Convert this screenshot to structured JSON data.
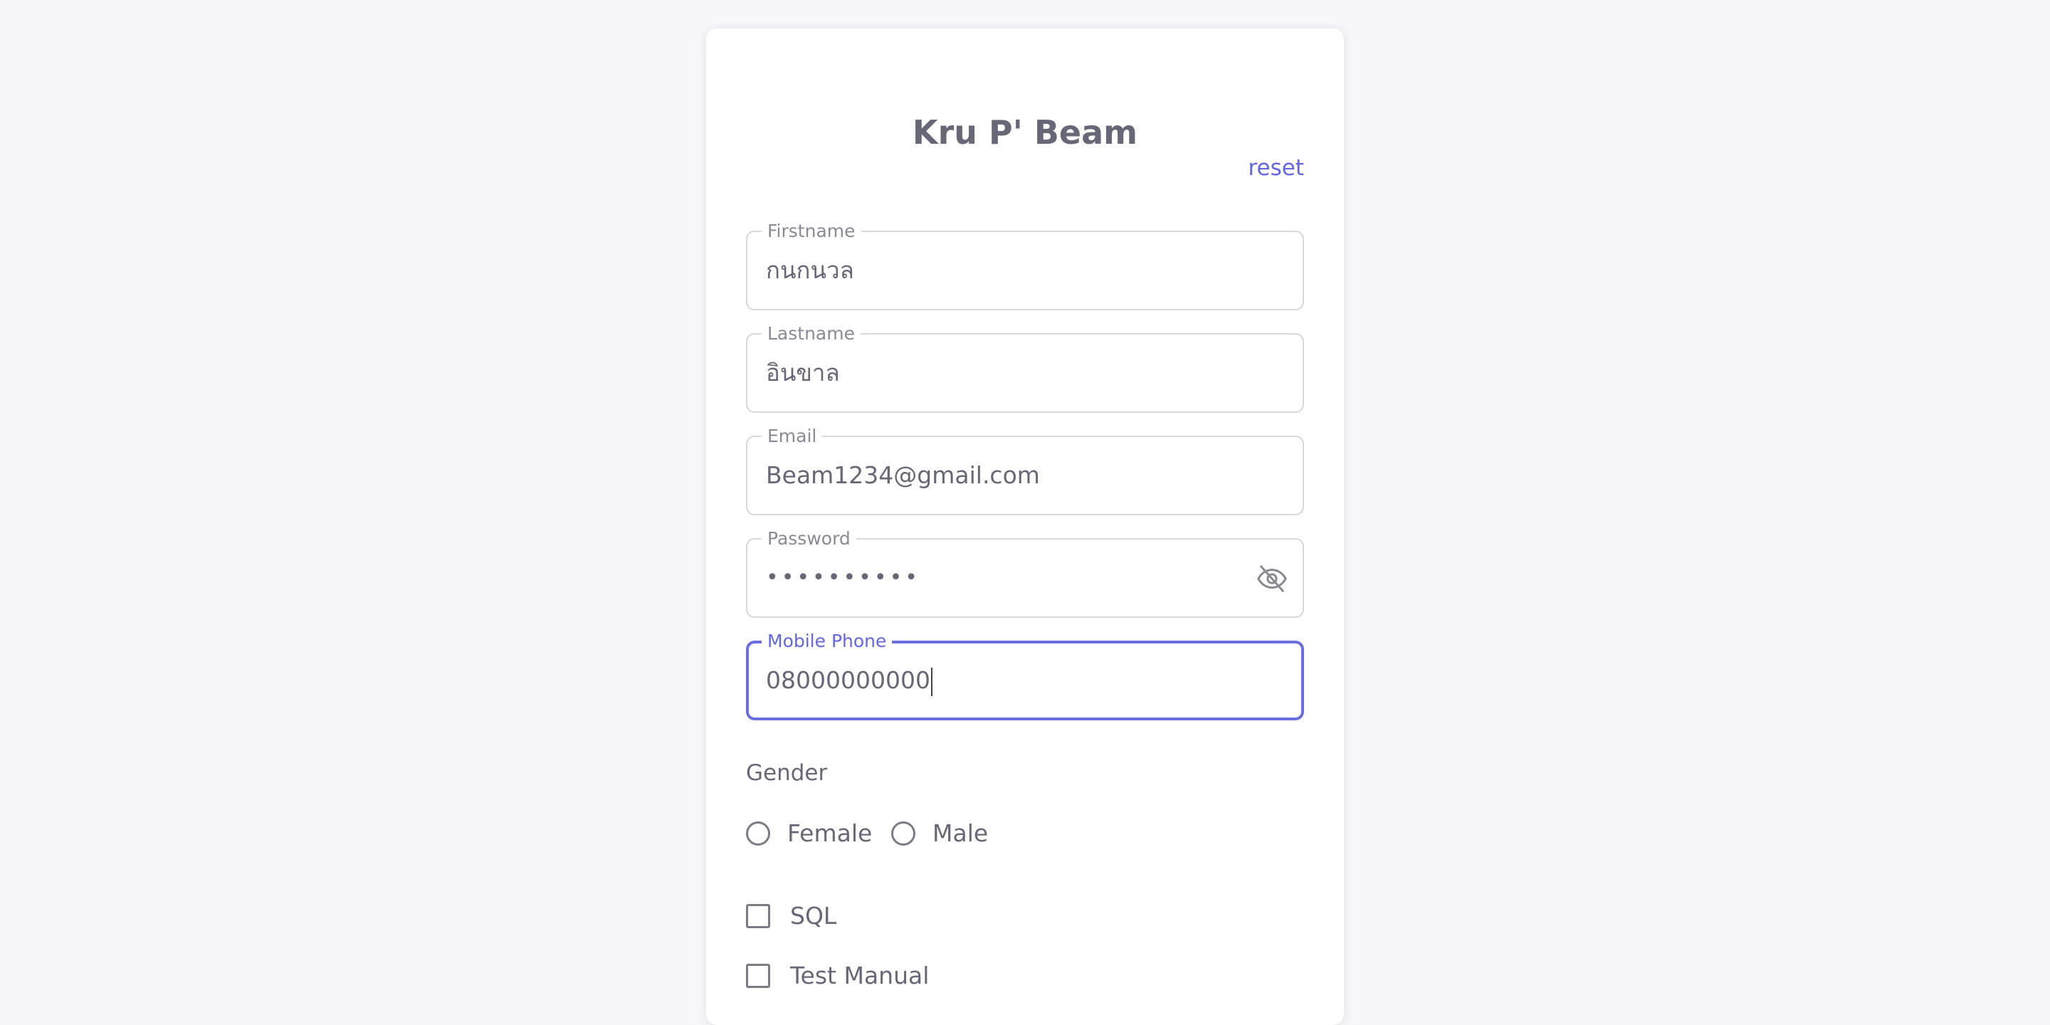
{
  "form": {
    "title": "Kru P' Beam",
    "reset_label": "reset"
  },
  "fields": {
    "firstname": {
      "label": "Firstname",
      "value": "กนกนวล"
    },
    "lastname": {
      "label": "Lastname",
      "value": "อินขาล"
    },
    "email": {
      "label": "Email",
      "value": "Beam1234@gmail.com"
    },
    "password": {
      "label": "Password",
      "value": "••••••••••",
      "toggle_icon": "eye-off-icon"
    },
    "mobile_phone": {
      "label": "Mobile Phone",
      "value": "08000000000",
      "focused": true
    }
  },
  "gender": {
    "label": "Gender",
    "options": [
      {
        "label": "Female",
        "checked": false
      },
      {
        "label": "Male",
        "checked": false
      }
    ]
  },
  "skills": [
    {
      "label": "SQL",
      "checked": false
    },
    {
      "label": "Test Manual",
      "checked": false
    }
  ],
  "colors": {
    "accent": "#6366e5",
    "text": "#676778",
    "border": "#d6d6db",
    "background": "#f7f7f9",
    "card": "#ffffff"
  }
}
